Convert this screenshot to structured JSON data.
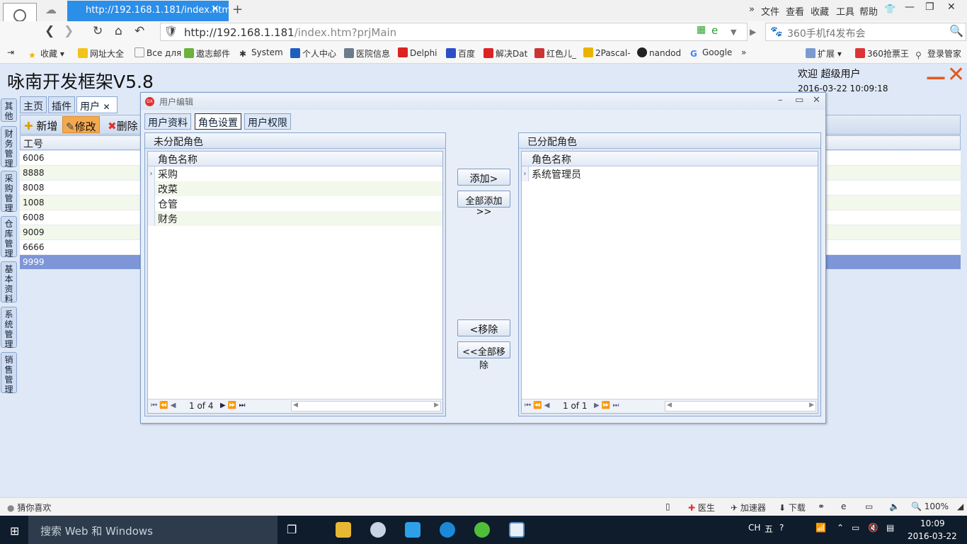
{
  "browser": {
    "tab_title": "http://192.168.1.181/index.htm",
    "address_host": "http://192.168.1.181",
    "address_path": "/index.htm?prjMain",
    "search_text": "360手机f4发布会",
    "menu": [
      "文件",
      "查看",
      "收藏",
      "工具",
      "帮助"
    ],
    "bookmarks": [
      "收藏",
      "网址大全",
      "Все для",
      "遨志邮件",
      "System",
      "个人中心",
      "医院信息",
      "Delphi",
      "百度",
      "解决Dat",
      "红色儿_",
      "2Pascal-",
      "nandod",
      "Google",
      "扩展",
      "360抢票王",
      "登录管家"
    ]
  },
  "app": {
    "title": "咏南开发框架V5.8",
    "welcome": "欢迎 超级用户",
    "datetime": "2016-03-22 10:09:18",
    "side_tabs": [
      "其他",
      "财务管理",
      "采购管理",
      "仓库管理",
      "基本资料",
      "系统管理",
      "销售管理"
    ],
    "tabs": [
      "主页",
      "插件",
      "用户"
    ],
    "toolbar": [
      "新增",
      "修改",
      "删除"
    ],
    "grid_header": "工号",
    "rows": [
      "6006",
      "8888",
      "8008",
      "1008",
      "6008",
      "9009",
      "6666",
      "9999"
    ]
  },
  "dialog": {
    "title": "用户编辑",
    "tabs": [
      "用户资料",
      "角色设置",
      "用户权限"
    ],
    "left_panel": {
      "title": "未分配角色",
      "column": "角色名称",
      "items": [
        "采购",
        "改菜",
        "仓管",
        "财务"
      ],
      "pager": "1 of 4"
    },
    "right_panel": {
      "title": "已分配角色",
      "column": "角色名称",
      "items": [
        "系统管理员"
      ],
      "pager": "1 of 1"
    },
    "buttons": {
      "add": "添加>",
      "add_all": "全部添加>>",
      "remove": "<移除",
      "remove_all": "<<全部移除"
    }
  },
  "status": {
    "left": "猜你喜欢",
    "items": [
      "医生",
      "加速器",
      "下载"
    ],
    "zoom": "100%"
  },
  "taskbar": {
    "search": "搜索 Web 和 Windows",
    "ime": "CH",
    "ime2": "五",
    "time": "10:09",
    "date": "2016-03-22"
  }
}
